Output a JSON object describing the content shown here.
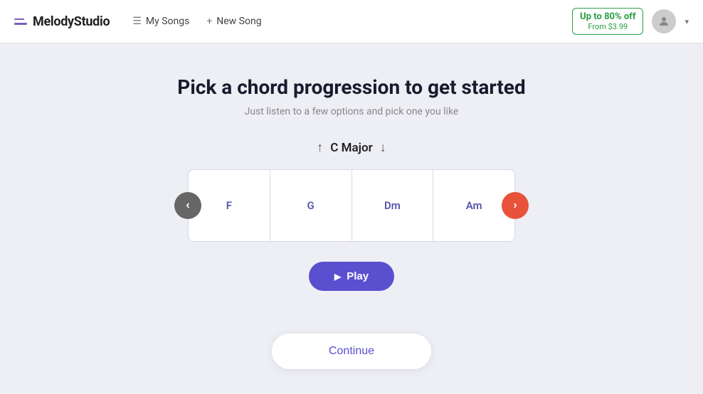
{
  "app": {
    "logo_text": "MelodyStudio"
  },
  "header": {
    "my_songs_label": "My Songs",
    "new_song_label": "New Song",
    "promo_main": "Up to 80% off",
    "promo_sub": "From $3.99"
  },
  "main": {
    "title": "Pick a chord progression to get started",
    "subtitle": "Just listen to a few options and pick one you like",
    "key_up_arrow": "↑",
    "key_label": "C  Major",
    "key_down_arrow": "↓",
    "chords": [
      {
        "name": "F"
      },
      {
        "name": "G"
      },
      {
        "name": "Dm"
      },
      {
        "name": "Am"
      }
    ],
    "play_label": "Play",
    "continue_label": "Continue"
  }
}
